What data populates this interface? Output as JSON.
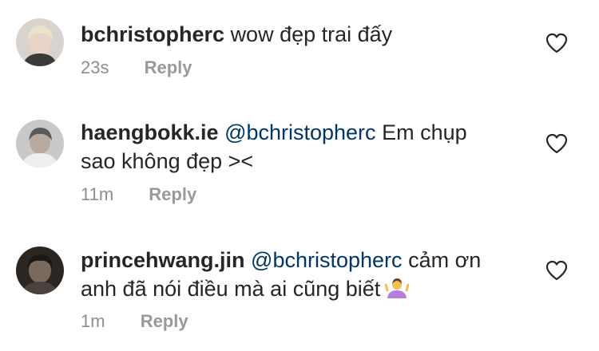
{
  "comments": [
    {
      "username": "bchristopherc",
      "mention": "",
      "text": "wow đẹp trai đấy",
      "text_line2": "",
      "time": "23s",
      "reply_label": "Reply",
      "avatar_icon": "avatar-blond-user",
      "like_icon": "heart-outline-icon"
    },
    {
      "username": "haengbokk.ie",
      "mention": "@bchristopherc",
      "text": "Em chụp",
      "text_line2": "sao không đẹp ><",
      "time": "11m",
      "reply_label": "Reply",
      "avatar_icon": "avatar-gray-user",
      "like_icon": "heart-outline-icon"
    },
    {
      "username": "princehwang.jin",
      "mention": "@bchristopherc",
      "text": "cảm ơn",
      "text_line2": "anh đã nói điều mà ai cũng biết",
      "emoji": "person-shrugging-emoji",
      "time": "1m",
      "reply_label": "Reply",
      "avatar_icon": "avatar-dark-user",
      "like_icon": "heart-outline-icon"
    }
  ],
  "colors": {
    "username": "#262626",
    "mention": "#003569",
    "meta": "#8e8e8e",
    "heart": "#262626"
  }
}
